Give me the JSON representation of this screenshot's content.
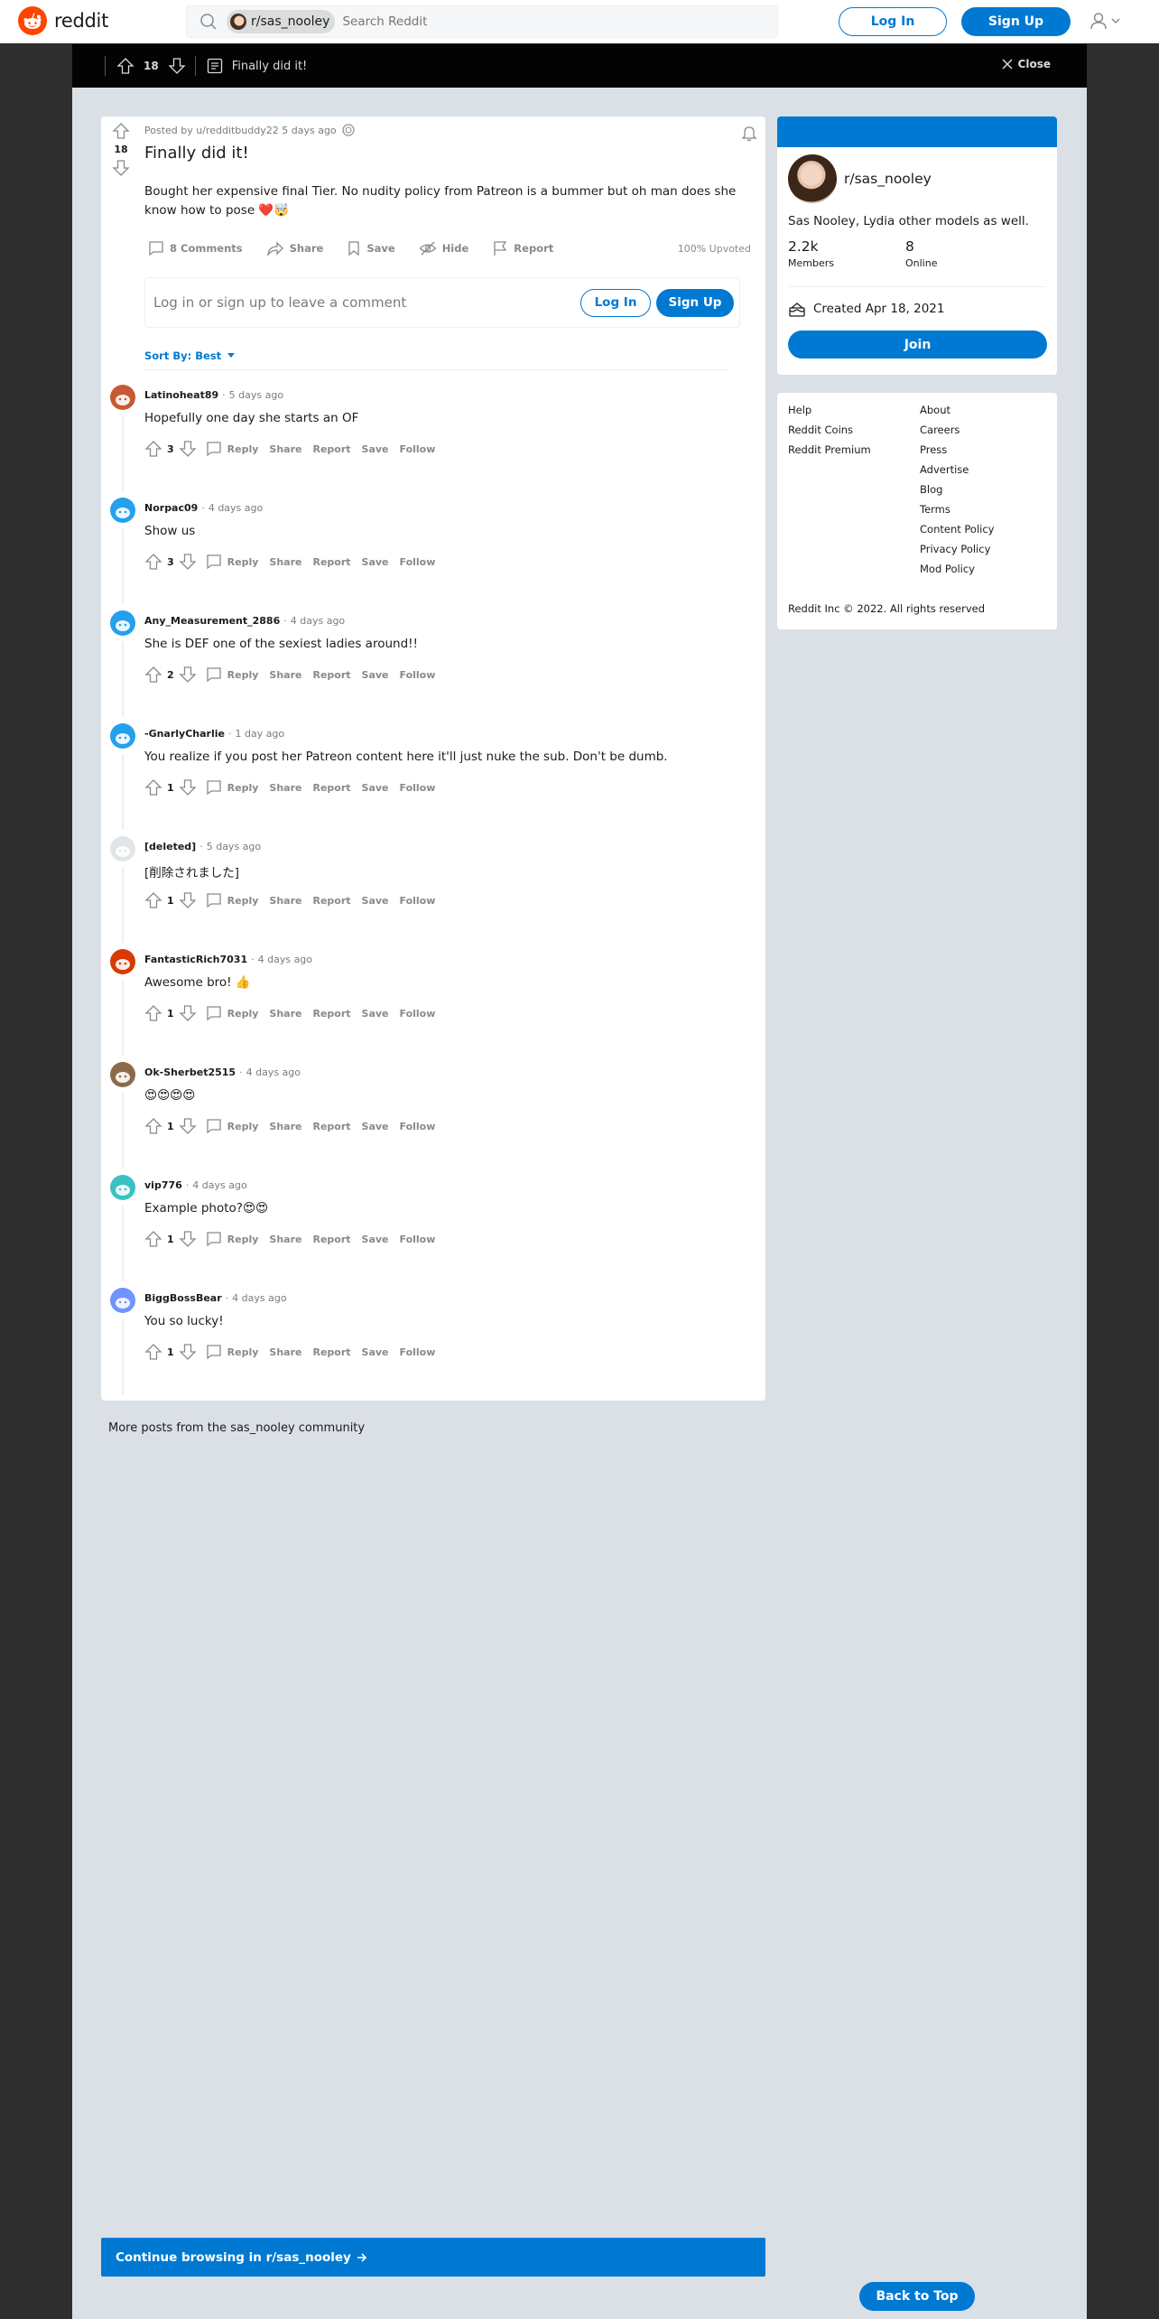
{
  "header": {
    "logo_text": "reddit",
    "search_chip": "r/sas_nooley",
    "search_placeholder": "Search Reddit",
    "login": "Log In",
    "signup": "Sign Up"
  },
  "overlay": {
    "vote_count": "18",
    "title": "Finally did it!",
    "close": "Close"
  },
  "post": {
    "vote_count": "18",
    "meta": "Posted by u/redditbuddy22 5 days ago",
    "title": "Finally did it!",
    "body": "Bought her expensive final Tier. No nudity policy from Patreon is a bummer but oh man does she know how to pose ❤️🤯",
    "actions": {
      "comments": "8 Comments",
      "share": "Share",
      "save": "Save",
      "hide": "Hide",
      "report": "Report"
    },
    "upvoted": "100% Upvoted"
  },
  "comment_box": {
    "prompt": "Log in or sign up to leave a comment",
    "login": "Log In",
    "signup": "Sign Up"
  },
  "sort": {
    "label": "Sort By: Best"
  },
  "comment_action_labels": {
    "reply": "Reply",
    "share": "Share",
    "report": "Report",
    "save": "Save",
    "follow": "Follow"
  },
  "comments": [
    {
      "author": "Latinoheat89",
      "time": "5 days ago",
      "text": "Hopefully one day she starts an OF",
      "score": "3"
    },
    {
      "author": "Norpac09",
      "time": "4 days ago",
      "text": "Show us",
      "score": "3"
    },
    {
      "author": "Any_Measurement_2886",
      "time": "4 days ago",
      "text": "She is DEF one of the sexiest ladies around!!",
      "score": "2"
    },
    {
      "author": "-GnarlyCharlie",
      "time": "1 day ago",
      "text": "You realize if you post her Patreon content here it'll just nuke the sub. Don't be dumb.",
      "score": "1"
    },
    {
      "author": "[deleted]",
      "time": "5 days ago",
      "text": "[削除されました]",
      "score": "1"
    },
    {
      "author": "FantasticRich7031",
      "time": "4 days ago",
      "text": "Awesome bro! 👍",
      "score": "1"
    },
    {
      "author": "Ok-Sherbet2515",
      "time": "4 days ago",
      "text": "😍😍😍😍",
      "score": "1"
    },
    {
      "author": "vip776",
      "time": "4 days ago",
      "text": "Example photo?😍😍",
      "score": "1"
    },
    {
      "author": "BiggBossBear",
      "time": "4 days ago",
      "text": "You so lucky!",
      "score": "1"
    }
  ],
  "sidebar": {
    "name": "r/sas_nooley",
    "description": "Sas Nooley, Lydia other models as well.",
    "members_value": "2.2k",
    "members_label": "Members",
    "online_value": "8",
    "online_label": "Online",
    "created": "Created Apr 18, 2021",
    "join": "Join"
  },
  "links": {
    "col1": [
      "Help",
      "Reddit Coins",
      "Reddit Premium"
    ],
    "col2": [
      "About",
      "Careers",
      "Press",
      "Advertise",
      "Blog",
      "Terms",
      "Content Policy",
      "Privacy Policy",
      "Mod Policy"
    ],
    "copyright": "Reddit Inc © 2022. All rights reserved"
  },
  "more_posts": "More posts from the sas_nooley community",
  "continue": "Continue browsing in r/sas_nooley",
  "back_to_top": "Back to Top",
  "colors": {
    "accent": "#0079d3",
    "reddit_orange": "#ff4500",
    "page_bg": "#dae0e6",
    "overlay_bg": "#030303"
  }
}
